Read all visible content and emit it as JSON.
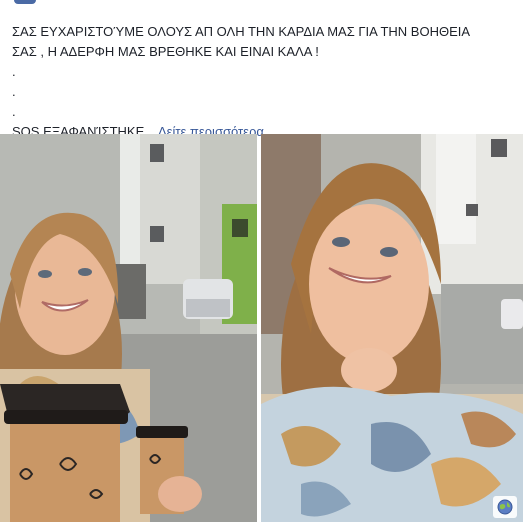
{
  "post": {
    "line1": "ΣΑΣ ΕΥΧΑΡΙΣΤΟΎΜΕ ΟΛΟΥΣ ΑΠ ΟΛΗ ΤΗΝ ΚΑΡΔΙΑ ΜΑΣ ΓΙΑ ΤΗΝ ΒΟΗΘΕΙΑ",
    "line2": "ΣΑΣ , Η ΑΔΕΡΦΗ ΜΑΣ ΒΡΕΘΗΚΕ ΚΑΙ ΕΙΝΑΙ ΚΑΛΑ !",
    "dot": ".",
    "truncated_text": "SOS ΕΞΑΦΑΝΊΣΤΗΚΕ...",
    "see_more_label": "Δείτε περισσότερα"
  },
  "photos": [
    {
      "icon": "photo-selfie-with-coffee-cups"
    },
    {
      "icon": "photo-selfie-smiling"
    }
  ],
  "badge": {
    "icon": "globe-icon"
  },
  "colors": {
    "link": "#385898",
    "text": "#1d2129"
  }
}
